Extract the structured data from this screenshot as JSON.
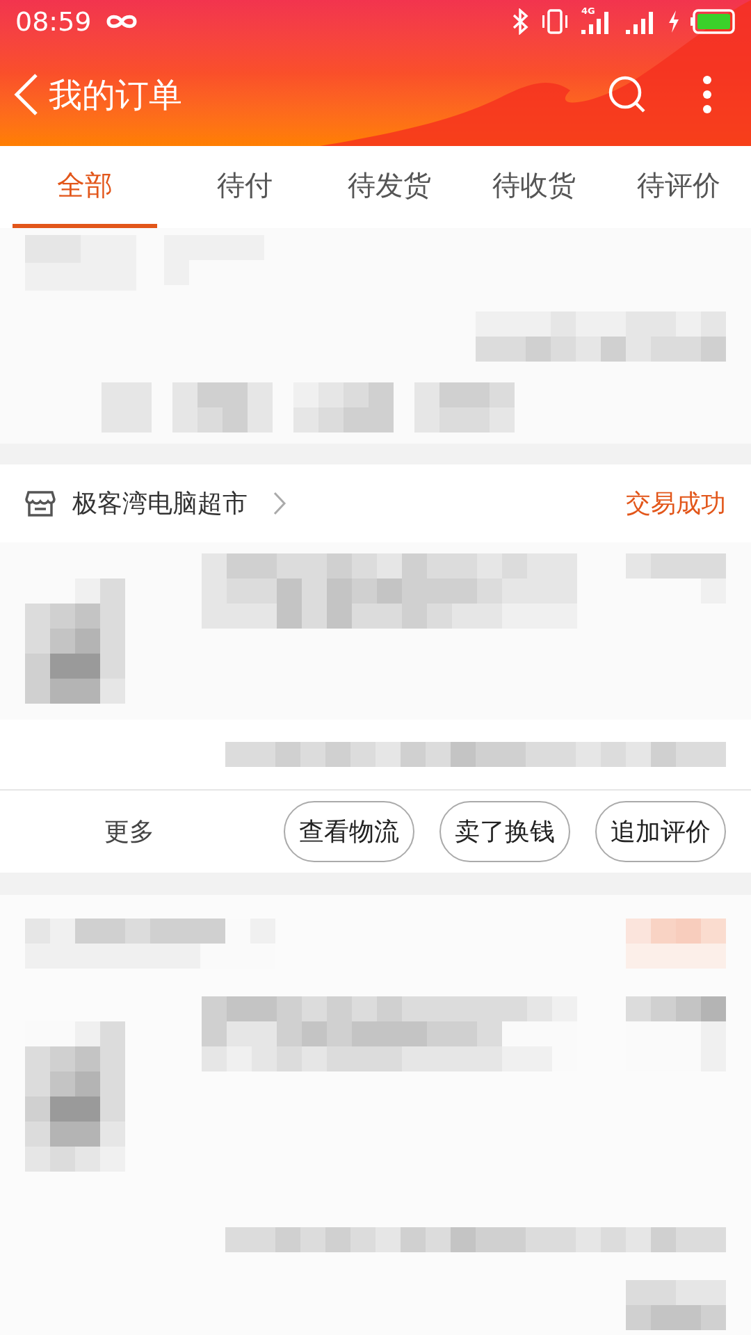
{
  "status_bar": {
    "time": "08:59",
    "network": "4G"
  },
  "header": {
    "title": "我的订单"
  },
  "tabs": [
    {
      "label": "全部",
      "selected": true
    },
    {
      "label": "待付",
      "selected": false
    },
    {
      "label": "待发货",
      "selected": false
    },
    {
      "label": "待收货",
      "selected": false
    },
    {
      "label": "待评价",
      "selected": false
    }
  ],
  "order": {
    "store": "极客湾电脑超市",
    "status": "交易成功",
    "more": "更多",
    "actions": [
      "查看物流",
      "卖了换钱",
      "追加评价"
    ]
  }
}
